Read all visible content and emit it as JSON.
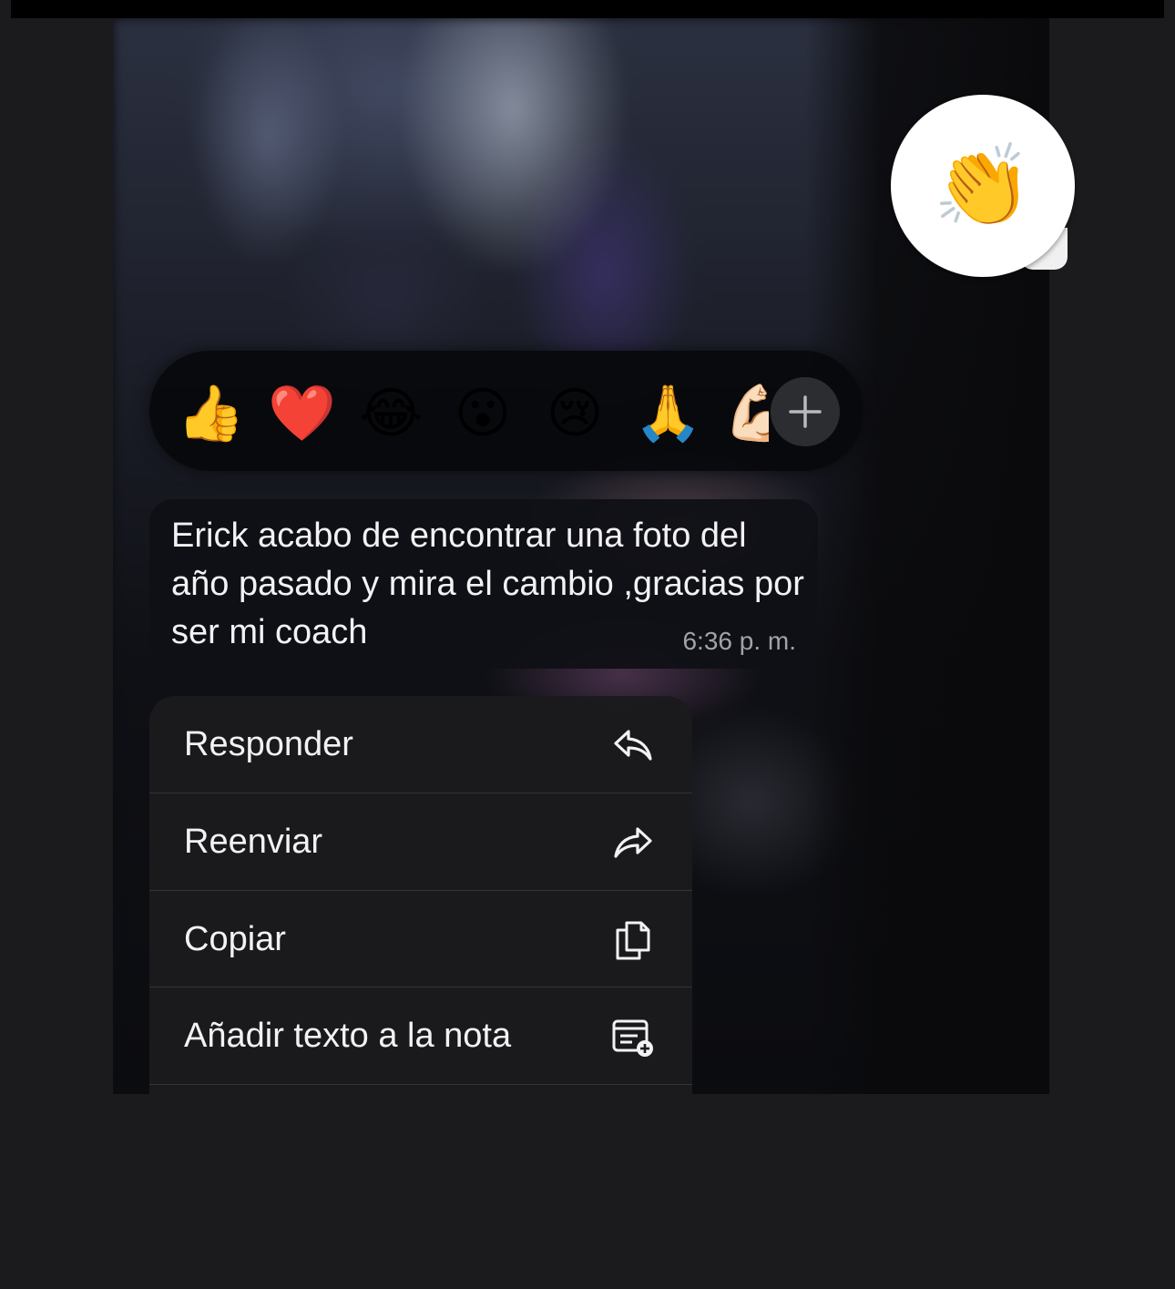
{
  "reaction": {
    "emoji": "👏"
  },
  "emoji_bar": {
    "items": [
      "👍",
      "❤️",
      "😂",
      "😮",
      "😢",
      "🙏",
      "💪🏻"
    ],
    "more_icon": "plus-icon"
  },
  "message": {
    "text": "Erick acabo de encontrar una foto del año pasado y mira el cambio ,gracias por ser mi coach",
    "time": "6:36 p. m."
  },
  "menu": {
    "items": [
      {
        "label": "Responder",
        "icon": "reply-icon"
      },
      {
        "label": "Reenviar",
        "icon": "forward-icon"
      },
      {
        "label": "Copiar",
        "icon": "copy-icon"
      },
      {
        "label": "Añadir texto a la nota",
        "icon": "add-note-icon"
      }
    ]
  },
  "colors": {
    "page_background": "#1b1b1d",
    "bubble": "#101116",
    "menu": "#1b1b1e",
    "text": "#f2f2f4",
    "muted": "#a2a3a8"
  }
}
